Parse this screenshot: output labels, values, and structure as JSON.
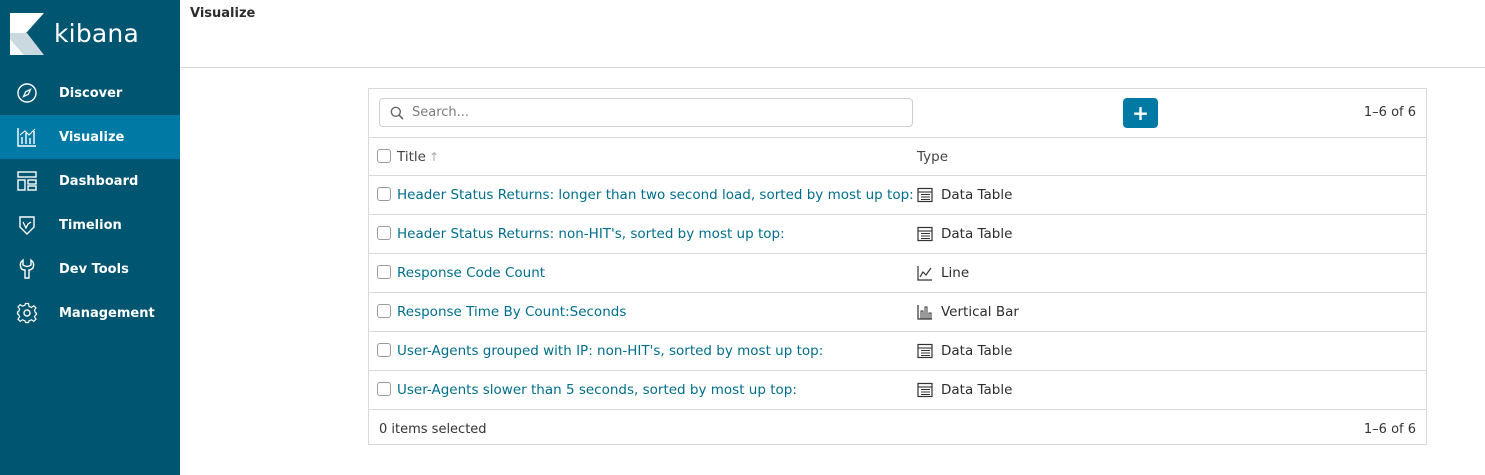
{
  "brand": {
    "name": "kibana"
  },
  "nav": {
    "items": [
      {
        "label": "Discover",
        "icon": "compass-icon"
      },
      {
        "label": "Visualize",
        "icon": "bar-chart-icon",
        "active": true
      },
      {
        "label": "Dashboard",
        "icon": "dashboard-icon"
      },
      {
        "label": "Timelion",
        "icon": "timelion-icon"
      },
      {
        "label": "Dev Tools",
        "icon": "wrench-icon"
      },
      {
        "label": "Management",
        "icon": "gear-icon"
      }
    ]
  },
  "header": {
    "title": "Visualize"
  },
  "toolbar": {
    "search_placeholder": "Search...",
    "add_label": "+",
    "pager": "1–6 of 6"
  },
  "table": {
    "columns": {
      "title": "Title",
      "sort_indicator": "↑",
      "type": "Type"
    },
    "rows": [
      {
        "title": "Header Status Returns: longer than two second load, sorted by most up top:",
        "type": "Data Table",
        "icon": "table-icon"
      },
      {
        "title": "Header Status Returns: non-HIT's, sorted by most up top:",
        "type": "Data Table",
        "icon": "table-icon"
      },
      {
        "title": "Response Code Count",
        "type": "Line",
        "icon": "line-chart-icon"
      },
      {
        "title": "Response Time By Count:Seconds",
        "type": "Vertical Bar",
        "icon": "vertical-bar-icon"
      },
      {
        "title": "User-Agents grouped with IP: non-HIT's, sorted by most up top:",
        "type": "Data Table",
        "icon": "table-icon"
      },
      {
        "title": "User-Agents slower than 5 seconds, sorted by most up top:",
        "type": "Data Table",
        "icon": "table-icon"
      }
    ]
  },
  "footer": {
    "selected": "0 items selected",
    "pager": "1–6 of 6"
  },
  "colors": {
    "sidebar": "#005571",
    "active": "#0079a5",
    "link": "#006e8a"
  }
}
